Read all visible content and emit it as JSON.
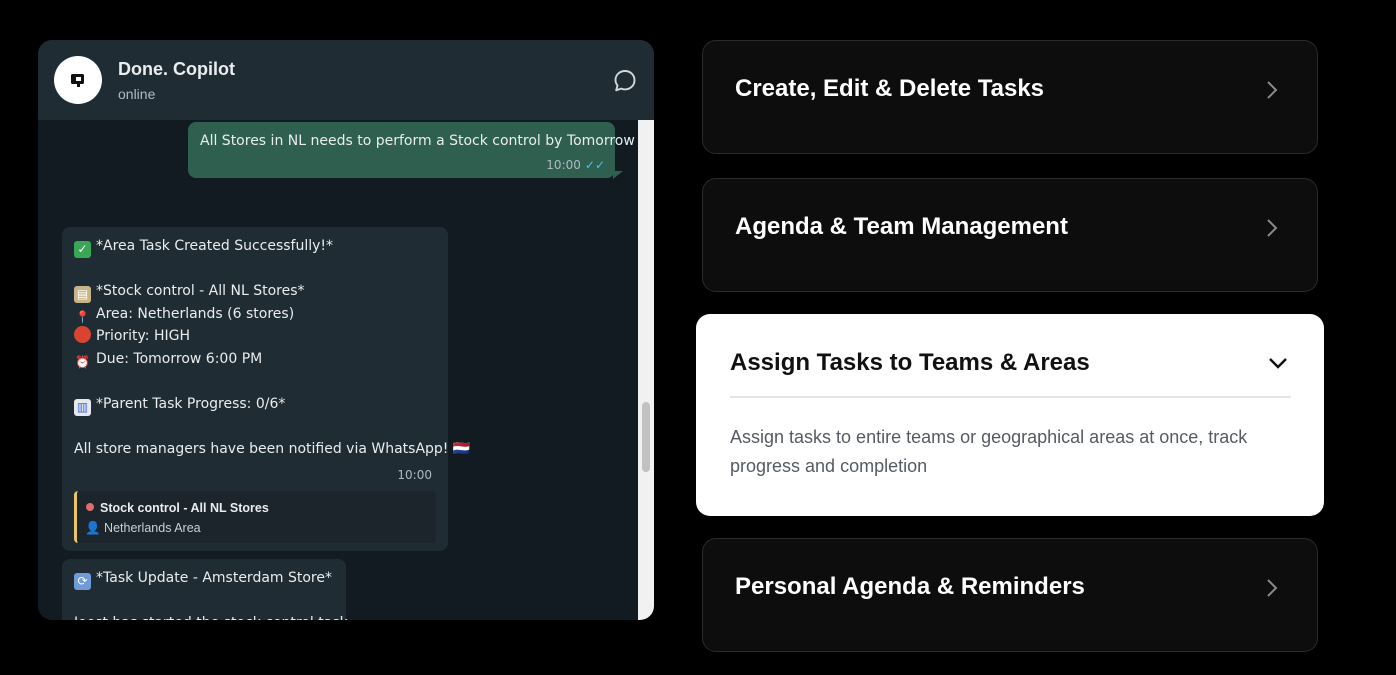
{
  "chat": {
    "contact_name": "Done. Copilot",
    "status": "online",
    "outgoing": {
      "text": "All Stores in NL needs to perform a Stock control by Tomorrow",
      "time": "10:00"
    },
    "task_message": {
      "lines": [
        {
          "icon": "check-emoji",
          "text": "*Area Task Created Successfully!*"
        },
        {
          "icon": "",
          "text": ""
        },
        {
          "icon": "clipboard-emoji",
          "text": "*Stock control - All NL Stores*"
        },
        {
          "icon": "pin-emoji",
          "text": "Area: Netherlands (6 stores)"
        },
        {
          "icon": "red-circle-emoji",
          "text": "Priority: HIGH"
        },
        {
          "icon": "alarm-clock-emoji",
          "text": "Due: Tomorrow 6:00 PM"
        },
        {
          "icon": "",
          "text": ""
        },
        {
          "icon": "bar-chart-emoji",
          "text": "*Parent Task Progress: 0/6*"
        },
        {
          "icon": "",
          "text": ""
        },
        {
          "icon": "",
          "text": "All store managers have been notified via WhatsApp! 🇳🇱"
        }
      ],
      "time": "10:00",
      "quote": {
        "title": "Stock control - All NL Stores",
        "subtitle": "👤 Netherlands Area"
      }
    },
    "update_message": {
      "lines": [
        {
          "icon": "refresh-emoji",
          "text": "*Task Update - Amsterdam Store*"
        },
        {
          "icon": "",
          "text": ""
        },
        {
          "icon": "",
          "text": "Joost has started the stock control task."
        }
      ]
    }
  },
  "features": [
    {
      "title": "Create, Edit & Delete Tasks",
      "expanded": false
    },
    {
      "title": "Agenda & Team Management",
      "expanded": false
    },
    {
      "title": "Assign Tasks to Teams & Areas",
      "expanded": true,
      "description": "Assign tasks to entire teams or geographical areas at once, track progress and completion"
    },
    {
      "title": "Personal Agenda & Reminders",
      "expanded": false
    }
  ],
  "colors": {
    "page_bg": "#000000",
    "chat_bg": "#111b21",
    "outgoing_bubble": "#2f5f4f",
    "incoming_bubble": "#202c33",
    "card_bg": "#0d0d0e",
    "open_card_bg": "#ffffff"
  }
}
